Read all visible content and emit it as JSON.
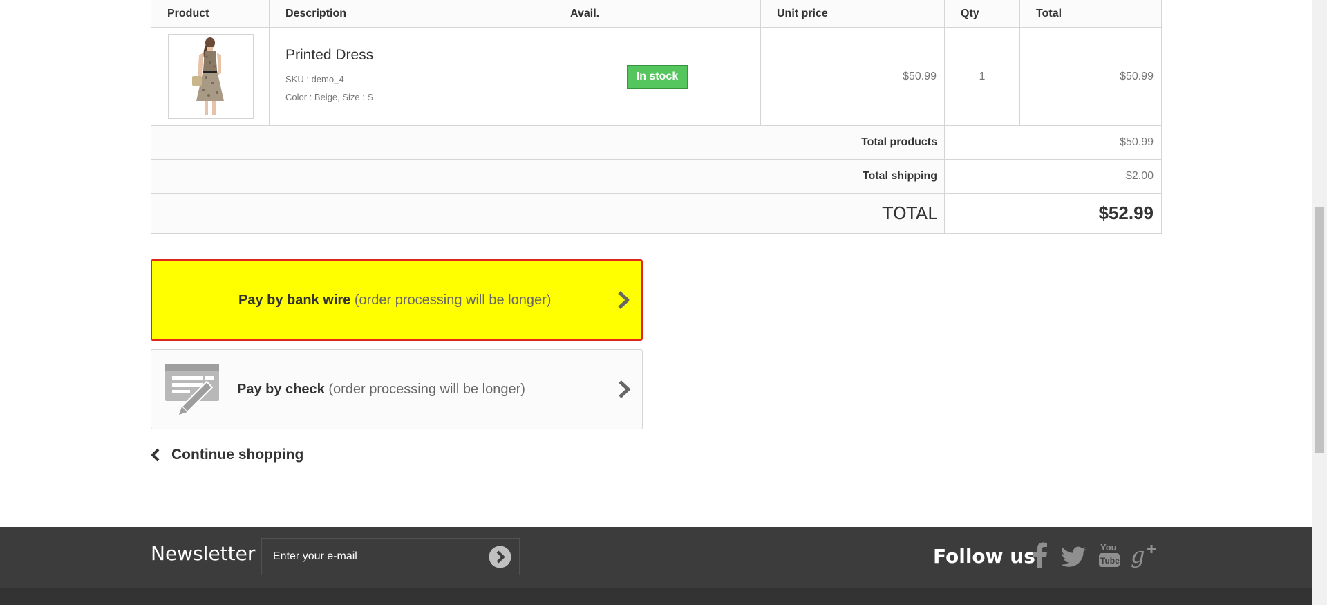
{
  "table": {
    "headers": {
      "product": "Product",
      "description": "Description",
      "avail": "Avail.",
      "unit_price": "Unit price",
      "qty": "Qty",
      "total": "Total"
    },
    "item": {
      "name": "Printed Dress",
      "sku": "SKU : demo_4",
      "attributes": "Color : Beige, Size : S",
      "availability": "In stock",
      "unit_price": "$50.99",
      "qty": "1",
      "total": "$50.99"
    },
    "totals": {
      "products_label": "Total products",
      "products_value": "$50.99",
      "shipping_label": "Total shipping",
      "shipping_value": "$2.00",
      "grand_label": "TOTAL",
      "grand_value": "$52.99"
    }
  },
  "payment": {
    "bank_wire": {
      "label": "Pay by bank wire",
      "note": "(order processing will be longer)"
    },
    "check": {
      "label": "Pay by check",
      "note": "(order processing will be longer)"
    }
  },
  "continue_label": "Continue shopping",
  "footer": {
    "newsletter_title": "Newsletter",
    "newsletter_placeholder": "Enter your e-mail",
    "follow_title": "Follow us"
  },
  "colors": {
    "stock_badge": "#55c65e",
    "bank_wire_bg": "#ffff00",
    "bank_wire_border": "#e3251e",
    "footer_bg": "#3c3c3c"
  },
  "icons": {
    "check_icon": "check-payment-icon",
    "chevron": "chevron-right-icon",
    "back": "chevron-left-icon",
    "social": [
      "facebook-icon",
      "twitter-icon",
      "youtube-icon",
      "google-plus-icon"
    ]
  }
}
